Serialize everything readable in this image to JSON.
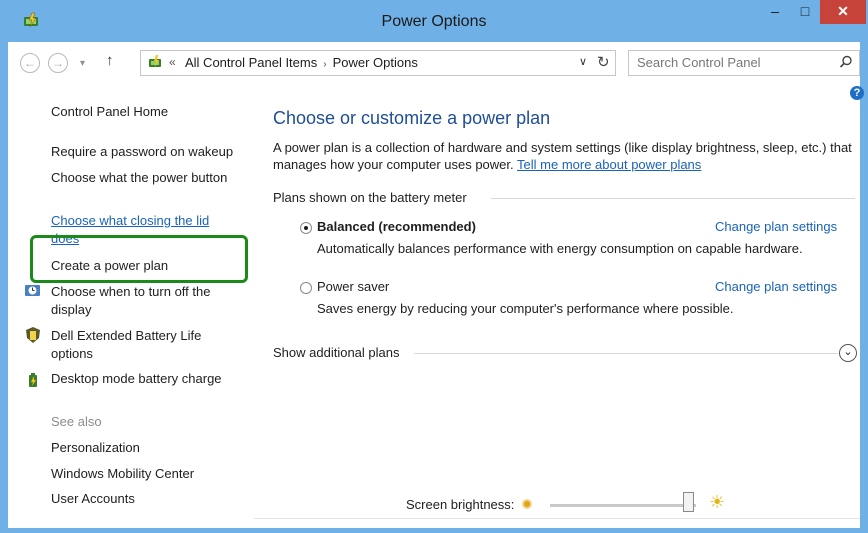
{
  "window": {
    "title": "Power Options",
    "minimize_glyph": "–",
    "maximize_glyph": "□",
    "close_glyph": "✕",
    "accent_color": "#6fb0e6",
    "close_color": "#c7433a"
  },
  "address": {
    "up_glyph": "↑",
    "chevron": "«",
    "crumbs": [
      "All Control Panel Items",
      "Power Options"
    ],
    "separator": "›",
    "dropdown_glyph": "∨",
    "refresh_glyph": "↻"
  },
  "search": {
    "placeholder": "Search Control Panel"
  },
  "help_glyph": "?",
  "sidebar": {
    "home": "Control Panel Home",
    "links": [
      "Require a password on wakeup",
      "Choose what the power button does",
      "Choose what closing the lid does",
      "Create a power plan",
      "Choose when to turn off the display",
      "Dell Extended Battery Life options",
      "Desktop mode battery charge"
    ],
    "see_also_label": "See also",
    "see_also": [
      "Personalization",
      "Windows Mobility Center",
      "User Accounts"
    ],
    "highlight_color": "#1b8a1b"
  },
  "main": {
    "title": "Choose or customize a power plan",
    "description": "A power plan is a collection of hardware and system settings (like display brightness, sleep, etc.) that manages how your computer uses power.",
    "learn_more": "Tell me more about power plans",
    "plans_header": "Plans shown on the battery meter",
    "plans": [
      {
        "name": "Balanced (recommended)",
        "selected": true,
        "description": "Automatically balances performance with energy consumption on capable hardware.",
        "link": "Change plan settings"
      },
      {
        "name": "Power saver",
        "selected": false,
        "description": "Saves energy by reducing your computer's performance where possible.",
        "link": "Change plan settings"
      }
    ],
    "additional_plans": "Show additional plans",
    "expand_glyph": "⌄"
  },
  "brightness": {
    "label": "Screen brightness:",
    "level_percent": 95,
    "high_glyph": "☀"
  },
  "link_color": "#1a63b8"
}
